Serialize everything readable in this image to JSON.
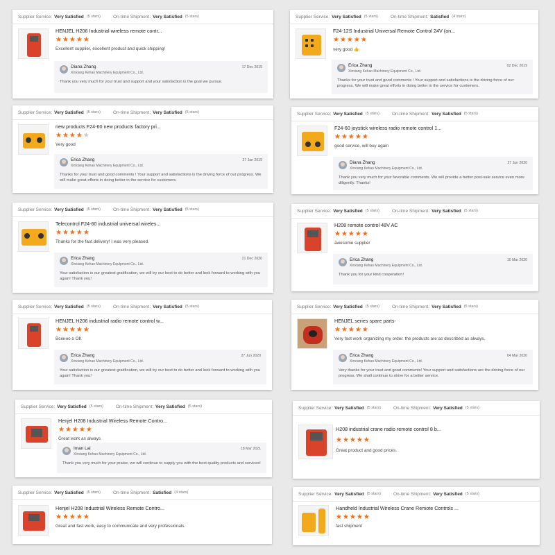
{
  "cards": [
    {
      "supplier_label": "Supplier Service:",
      "supplier_value": "Very Satisfied",
      "supplier_stars": "(5 stars)",
      "shipment_label": "On-time Shipment:",
      "shipment_value": "Very Satisfied",
      "shipment_stars": "(5 stars)",
      "title": "HENJEL H206 Industrial wireless remote contr...",
      "rating": 5,
      "stars_text": "★★★★★",
      "stars_off": "",
      "comment": "Excellent supplier, excellent product and quick shipping!",
      "reply": {
        "name": "Diana Zhang",
        "company": "Xinxiang Kehao Machinery Equipment Co., Ltd.",
        "date": "17 Dec 2019",
        "text": "Thank you very much for your trust and support and your satisfaction is the goal we pursue."
      }
    },
    {
      "supplier_label": "Supplier Service:",
      "supplier_value": "Very Satisfied",
      "supplier_stars": "(5 stars)",
      "shipment_label": "On-time Shipment:",
      "shipment_value": "Satisfied",
      "shipment_stars": "(4 stars)",
      "title": "F24-12S Industrial Universal Remote Control 24V (on...",
      "rating": 5,
      "stars_text": "★★★★★",
      "stars_off": "",
      "comment": "very good 👍",
      "reply": {
        "name": "Erica Zhang",
        "company": "Xinxiang Kehao Machinery Equipment Co., Ltd.",
        "date": "02 Dec 2019",
        "text": "Thanks for your trust and good comments ! Your support and  satisfactions  is the driving force of our progress. We will make great efforts in doing better in the service for customers."
      }
    },
    {
      "supplier_label": "Supplier Service:",
      "supplier_value": "Very Satisfied",
      "supplier_stars": "(5 stars)",
      "shipment_label": "On-time Shipment:",
      "shipment_value": "Very Satisfied",
      "shipment_stars": "(5 stars)",
      "title": "new products F24-60 new products factory pri...",
      "rating": 4,
      "stars_text": "★★★★",
      "stars_off": "★",
      "comment": "Very good",
      "reply": {
        "name": "Erica Zhang",
        "company": "Xinxiang Kehao Machinery Equipment Co., Ltd.",
        "date": "27 Jan 2019",
        "text": "Thanks for your trust and good comments ! Your support and  satisfactions  is the driving force of our progress. We will make great efforts in doing better in the service for customers."
      }
    },
    {
      "supplier_label": "Supplier Service:",
      "supplier_value": "Very Satisfied",
      "supplier_stars": "(5 stars)",
      "shipment_label": "On-time Shipment:",
      "shipment_value": "Very Satisfied",
      "shipment_stars": "(5 stars)",
      "title": "F24-60 joystick wireless radio remote control 1...",
      "rating": 5,
      "stars_text": "★★★★★",
      "stars_off": "",
      "comment": "good service, will buy again",
      "reply": {
        "name": "Diana Zhang",
        "company": "Xinxiang Kehao Machinery Equipment Co., Ltd.",
        "date": "27 Jun 2020",
        "text": "Thank you very much for your favorable comments. We will provide a better post-sale service even more diligently. Thanks!"
      }
    },
    {
      "supplier_label": "Supplier Service:",
      "supplier_value": "Very Satisfied",
      "supplier_stars": "(5 stars)",
      "shipment_label": "On-time Shipment:",
      "shipment_value": "Very Satisfied",
      "shipment_stars": "(5 stars)",
      "title": "Telecontrol F24-60 industrial universal wireles...",
      "rating": 5,
      "stars_text": "★★★★★",
      "stars_off": "",
      "comment": "Thanks for the fast delivery! I was very pleased.",
      "reply": {
        "name": "Erica Zhang",
        "company": "Xinxiang Kehao Machinery Equipment Co., Ltd.",
        "date": "21 Dec 2020",
        "text": "Your satisfaction is our greatest gratification, we will try our best to do better and look forward to working with you again! Thank you!"
      }
    },
    {
      "supplier_label": "Supplier Service:",
      "supplier_value": "Very Satisfied",
      "supplier_stars": "(5 stars)",
      "shipment_label": "On-time Shipment:",
      "shipment_value": "Very Satisfied",
      "shipment_stars": "(5 stars)",
      "title": "H208 remote control 48V AC",
      "rating": 5,
      "stars_text": "★★★★★",
      "stars_off": "",
      "comment": "awesome supplier",
      "reply": {
        "name": "Erica Zhang",
        "company": "Xinxiang Kehao Machinery Equipment Co., Ltd.",
        "date": "10 Mar 2020",
        "text": "Thank you for your kind cooperation!"
      }
    },
    {
      "supplier_label": "Supplier Service:",
      "supplier_value": "Very Satisfied",
      "supplier_stars": "(5 stars)",
      "shipment_label": "On-time Shipment:",
      "shipment_value": "Very Satisfied",
      "shipment_stars": "(5 stars)",
      "title": "HENJEL H206 industrial radio remote control w...",
      "rating": 5,
      "stars_text": "★★★★★",
      "stars_off": "",
      "comment": "Всенно о ОК",
      "reply": {
        "name": "Erica Zhang",
        "company": "Xinxiang Kehao Machinery Equipment Co., Ltd.",
        "date": "27 Jun 2020",
        "text": "Your satisfaction is our greatest gratification, we will try our best to do better and look forward to working with you again! Thank you!"
      }
    },
    {
      "supplier_label": "Supplier Service:",
      "supplier_value": "Very Satisfied",
      "supplier_stars": "(5 stars)",
      "shipment_label": "On-time Shipment:",
      "shipment_value": "Very Satisfied",
      "shipment_stars": "(5 stars)",
      "title": "HENJEL series spare parts-",
      "rating": 5,
      "stars_text": "★★★★★",
      "stars_off": "",
      "comment": "Very fast work organizing my order. the products are as described as always.",
      "reply": {
        "name": "Erica Zhang",
        "company": "Xinxiang Kehao Machinery Equipment Co., Ltd.",
        "date": "04 Mar 2020",
        "text": "Very thanks for your trust and good comments! Your support and satisfactions are the driving force of our progress. We shall continue to strive for a better service."
      }
    },
    {
      "supplier_label": "Supplier Service:",
      "supplier_value": "Very Satisfied",
      "supplier_stars": "(5 stars)",
      "shipment_label": "On-time Shipment:",
      "shipment_value": "Very Satisfied",
      "shipment_stars": "(5 stars)",
      "title": "Henjel H208 Industrial Wireless Remote Contro...",
      "rating": 5,
      "stars_text": "★★★★★",
      "stars_off": "",
      "comment": "Great work as always",
      "reply": {
        "name": "Iman Lai",
        "company": "Xinxiang Kehao Machinery Equipment Co., Ltd.",
        "date": "18 Mar 2021",
        "text": "Thank you very much for your praise, we will continue to supply you with the best quality products and services!"
      }
    },
    {
      "supplier_label": "Supplier Service:",
      "supplier_value": "Very Satisfied",
      "supplier_stars": "(5 stars)",
      "shipment_label": "On-time Shipment:",
      "shipment_value": "Very Satisfied",
      "shipment_stars": "(5 stars)",
      "title": "H208 industrial crane radio remote control 8 b...",
      "rating": 5,
      "stars_text": "★★★★★",
      "stars_off": "",
      "comment": "Great product and good prices.",
      "reply": null
    },
    {
      "supplier_label": "Supplier Service:",
      "supplier_value": "Very Satisfied",
      "supplier_stars": "(5 stars)",
      "shipment_label": "On-time Shipment:",
      "shipment_value": "Satisfied",
      "shipment_stars": "(4 stars)",
      "title": "Henjel H208 Industrial Wireless Remote Contro...",
      "rating": 5,
      "stars_text": "★★★★★",
      "stars_off": "",
      "comment": "Great and fast work, easy to communicate and very professionals.",
      "reply": null
    },
    {
      "supplier_label": "Supplier Service:",
      "supplier_value": "Very Satisfied",
      "supplier_stars": "(5 stars)",
      "shipment_label": "On-time Shipment:",
      "shipment_value": "Very Satisfied",
      "shipment_stars": "(5 stars)",
      "title": "Handheld Industrial Wireless Crane Remote Controls ...",
      "rating": 5,
      "stars_text": "★★★★★",
      "stars_off": "",
      "comment": "fast shipment",
      "reply": null
    }
  ],
  "colors": {
    "star": "#f06d1a",
    "star_off": "#c8c8c8",
    "background": "#e9e9e9"
  }
}
